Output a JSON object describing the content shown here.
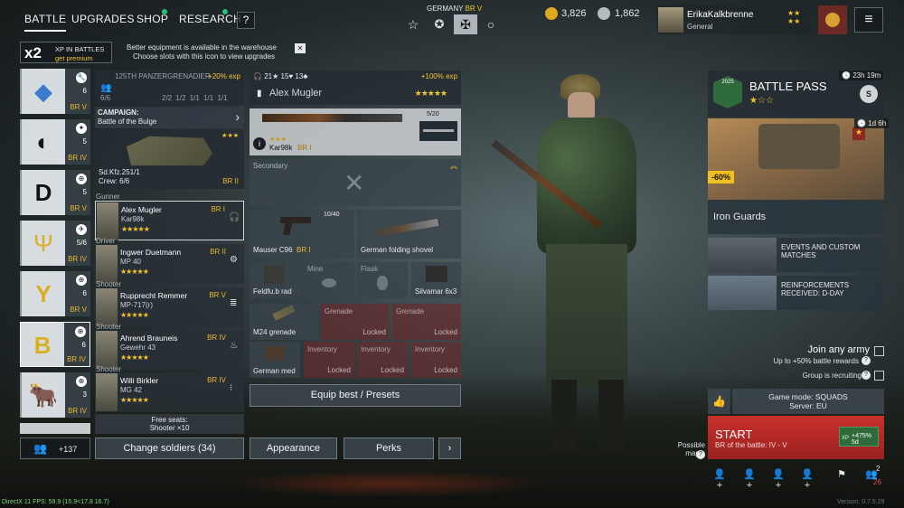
{
  "nav": {
    "battle": "BATTLE",
    "upgrades": "UPGRADES",
    "shop": "SHOP",
    "research": "RESEARCH",
    "help": "?"
  },
  "header": {
    "nation": "GERMANY",
    "nation_br": "BR V"
  },
  "currency": {
    "gold": "3,826",
    "silver": "1,862"
  },
  "player": {
    "name": "ErikaKalkbrenne",
    "rank": "General",
    "stars": "★★\n★★"
  },
  "banner": {
    "multiplier": "x2",
    "xp_label": "XP IN BATTLES",
    "premium": "get premium",
    "warehouse": "Better equipment is available in the warehouse",
    "hint": "Choose slots with this icon to view upgrades",
    "close": "✕"
  },
  "squads": [
    {
      "count": "6",
      "br": "BR V",
      "emblem": "◆",
      "badge": "🔧"
    },
    {
      "count": "5",
      "br": "BR IV",
      "emblem": "◐",
      "badge": "✦"
    },
    {
      "count": "5",
      "br": "BR V",
      "emblem": "D",
      "badge": "⊕"
    },
    {
      "count": "5/6",
      "br": "BR IV",
      "emblem": "Ψ",
      "badge": "✈"
    },
    {
      "count": "6",
      "br": "BR V",
      "emblem": "Y",
      "badge": "⊕"
    },
    {
      "count": "6",
      "br": "BR IV",
      "emblem": "B",
      "badge": "⊕"
    },
    {
      "count": "3",
      "br": "BR IV",
      "emblem": "🐂",
      "badge": "⊕"
    }
  ],
  "squad_footer": {
    "members": "+137"
  },
  "unit": {
    "name": "125TH PANZERGRENADIER",
    "exp": "+20% exp",
    "count": "6/6",
    "stats": [
      "2/2",
      "1/2",
      "1/1",
      "1/1",
      "1/1"
    ]
  },
  "campaign": {
    "label": "CAMPAIGN:",
    "name": "Battle of the Bulge"
  },
  "vehicle": {
    "name": "Sd.Kfz.251/1",
    "crew": "Crew: 6/6",
    "br": "BR II",
    "stars": "★★★"
  },
  "soldiers": [
    {
      "role": "Gunner",
      "name": "Alex Mugler",
      "weapon": "Kar98k",
      "br": "BR I",
      "stars": "★★★★★",
      "icon": "🎧"
    },
    {
      "role": "Driver",
      "name": "Ingwer Duetmann",
      "weapon": "MP 40",
      "br": "BR II",
      "stars": "★★★★★",
      "icon": "⚙"
    },
    {
      "role": "Shooter",
      "name": "Rupprecht Remmer",
      "weapon": "MP-717(r)",
      "br": "BR V",
      "stars": "★★★★★",
      "icon": "≣"
    },
    {
      "role": "Shooter",
      "name": "Ahrend Brauneis",
      "weapon": "Gewehr 43",
      "br": "BR IV",
      "stars": "★★★★★",
      "icon": "♨"
    },
    {
      "role": "Shooter",
      "name": "Willi Birkler",
      "weapon": "MG 42",
      "br": "BR IV",
      "stars": "★★★★★",
      "icon": "⁝"
    }
  ],
  "seats": {
    "title": "Free seats:",
    "detail": "Shooter ×10"
  },
  "change_soldiers": "Change soldiers (34)",
  "soldier_detail": {
    "stats": [
      "21",
      "15",
      "13"
    ],
    "exp": "+100% exp",
    "name": "Alex Mugler",
    "stars": "★★★★★"
  },
  "primary": {
    "name": "Kar98k",
    "br": "BR I",
    "ammo": "5/20",
    "stars": "★★★"
  },
  "secondary": {
    "label": "Secondary"
  },
  "sidearm": {
    "name": "Mauser C96",
    "br": "BR I",
    "ammo": "10/40"
  },
  "melee": {
    "name": "German folding shovel"
  },
  "gear": [
    {
      "name": "Feldfu.b rad"
    },
    {
      "name": "Mine"
    },
    {
      "name": "Flask"
    },
    {
      "name": "Silvamar 6x3"
    }
  ],
  "grenade": {
    "name": "M24 grenade"
  },
  "locked_grenade": [
    {
      "t": "Grenade",
      "l": "Locked"
    },
    {
      "t": "Grenade",
      "l": "Locked"
    }
  ],
  "medkit": {
    "name": "German med"
  },
  "locked_inv": [
    {
      "t": "Inventory",
      "l": "Locked"
    },
    {
      "t": "Inventory",
      "l": "Locked"
    },
    {
      "t": "Inventory",
      "l": "Locked"
    }
  ],
  "equip_best": "Equip best / Presets",
  "appearance": "Appearance",
  "perks": "Perks",
  "next": "›",
  "battlepass": {
    "timer": "23h 19m",
    "title": "BATTLE PASS",
    "stars": "★☆☆",
    "discount": "-60%",
    "event_timer": "1d 6h",
    "event_name": "Iron Guards",
    "year": "2025"
  },
  "events": [
    {
      "title": "EVENTS AND CUSTOM MATCHES"
    },
    {
      "title": "REINFORCEMENTS RECEIVED: D-DAY"
    }
  ],
  "join": {
    "title": "Join any army",
    "bonus": "Up to +50% battle rewards",
    "group": "Group is recruiting"
  },
  "mode": {
    "line1": "Game mode: SQUADS",
    "line2": "Server: EU"
  },
  "start": {
    "label": "START",
    "sub": "BR of the battle: IV - V",
    "xp": "+475% 5d",
    "xp_tag": "XP"
  },
  "maps": {
    "label": "Possible\nmaps:"
  },
  "bottom_icons": {
    "squad_count": "2",
    "members": "26"
  },
  "footer": {
    "fps": "DirectX 11 FPS: 59.9 (15.9<17.8 16.7)",
    "version": "Version: 0.7.5.29"
  }
}
